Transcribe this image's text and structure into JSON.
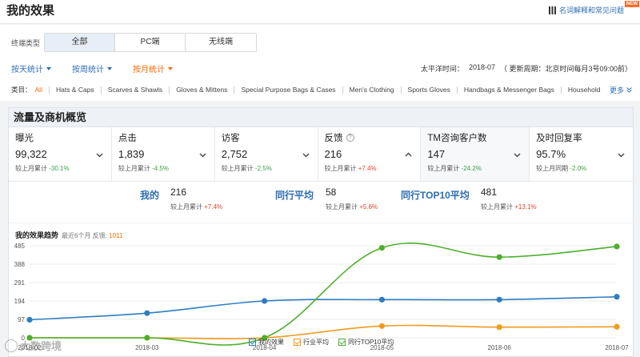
{
  "header": {
    "title": "我的效果",
    "help_link": "名词解释和常见问题",
    "new_badge": "NEW"
  },
  "filters": {
    "terminal_label": "终端类型",
    "terminal_tabs": [
      "全部",
      "PC端",
      "无线端"
    ],
    "terminal_active": 0,
    "periods": [
      "按天统计",
      "按周统计",
      "按月统计"
    ],
    "period_active": 2,
    "time_zone_label": "太平洋时间：",
    "time_value": "2018-07",
    "update_note": "（ 更新周期：北京时间每月3号09:00前）",
    "category_label": "类目：",
    "categories": [
      "All",
      "Hats & Caps",
      "Scarves & Shawls",
      "Gloves & Mittens",
      "Special Purpose Bags & Cases",
      "Men's Clothing",
      "Sports Gloves",
      "Handbags & Messenger Bags",
      "Household"
    ],
    "more_label": "更多"
  },
  "overview": {
    "title": "流量及商机概览",
    "metrics": [
      {
        "name": "曝光",
        "value": "99,322",
        "compare_label": "较上月累计",
        "change": "-30.1%",
        "dir": "down",
        "help": "",
        "chevron": "down"
      },
      {
        "name": "点击",
        "value": "1,839",
        "compare_label": "较上月累计",
        "change": "-4.5%",
        "dir": "down",
        "help": "",
        "chevron": "down"
      },
      {
        "name": "访客",
        "value": "2,752",
        "compare_label": "较上月累计",
        "change": "-2.5%",
        "dir": "down",
        "help": "",
        "chevron": "down"
      },
      {
        "name": "反馈",
        "value": "216",
        "compare_label": "较上月累计",
        "change": "+7.4%",
        "dir": "up",
        "help": "?",
        "chevron": "up"
      },
      {
        "name": "TM咨询客户数",
        "value": "147",
        "compare_label": "较上月累计",
        "change": "-24.2%",
        "dir": "down",
        "help": "",
        "chevron": "down"
      },
      {
        "name": "及时回复率",
        "value": "95.7%",
        "compare_label": "较上月同期",
        "change": "-2.0%",
        "dir": "down",
        "help": "",
        "chevron": "down"
      }
    ],
    "comparison": [
      {
        "title": "我的",
        "value": "216",
        "compare_label": "较上月累计",
        "change": "+7.4%"
      },
      {
        "title": "同行平均",
        "value": "58",
        "compare_label": "较上月累计",
        "change": "+5.6%"
      },
      {
        "title": "同行TOP10平均",
        "value": "481",
        "compare_label": "较上月累计",
        "change": "+13.1%"
      }
    ]
  },
  "trend": {
    "title": "我的效果趋势",
    "subtitle": "最近6个月 反馈:",
    "highlight": "1011"
  },
  "chart_data": {
    "type": "line",
    "x": [
      "2018-02",
      "2018-03",
      "2018-04",
      "2018-05",
      "2018-06",
      "2018-07"
    ],
    "ylim": [
      0,
      485
    ],
    "yticks": [
      0,
      97,
      194,
      291,
      388,
      485
    ],
    "series": [
      {
        "name": "我的效果",
        "color": "#2e7dc3",
        "values": [
          95,
          130,
          194,
          201,
          201,
          216
        ]
      },
      {
        "name": "行业平均",
        "color": "#f39a1e",
        "values": [
          0,
          0,
          0,
          62,
          56,
          58
        ]
      },
      {
        "name": "同行TOP10平均",
        "color": "#4caf2a",
        "values": [
          0,
          0,
          0,
          474,
          425,
          481
        ]
      }
    ]
  },
  "watermark": "大数跨境"
}
